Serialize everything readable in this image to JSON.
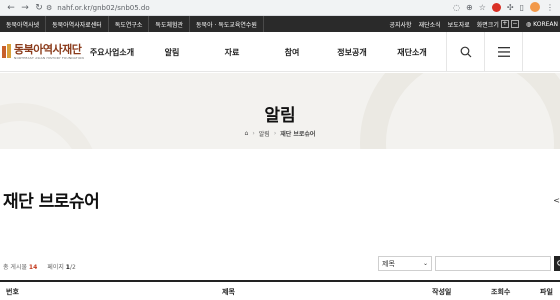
{
  "browser": {
    "url": "nahf.or.kr/gnb02/snb05.do"
  },
  "util_bar": {
    "left_links": [
      "동북아역사넷",
      "동북아역사자료센터",
      "독도연구소",
      "독도체험관",
      "동북아 · 독도교육연수원"
    ],
    "right_links": [
      "공지사항",
      "재단소식",
      "보도자료"
    ],
    "zoom_label": "화면크기",
    "zoom_plus": "+",
    "zoom_minus": "−",
    "language": "KOREAN"
  },
  "header": {
    "logo_ko": "동북아역사재단",
    "logo_en": "NORTHEAST ASIAN HISTORY FOUNDATION",
    "gnb": [
      "주요사업소개",
      "알림",
      "자료",
      "참여",
      "정보공개",
      "재단소개"
    ]
  },
  "hero": {
    "title": "알림",
    "breadcrumb": [
      "알림",
      "재단 브로슈어"
    ]
  },
  "content": {
    "heading": "재단 브로슈어",
    "share_edge": "<",
    "total_label": "총 게시물",
    "total_count": "14",
    "page_label": "페이지",
    "page_current": "1",
    "page_total": "/2",
    "search_select": "제목",
    "search_placeholder": ""
  },
  "table": {
    "headers": [
      "번호",
      "제목",
      "작성일",
      "조회수",
      "파일"
    ]
  }
}
